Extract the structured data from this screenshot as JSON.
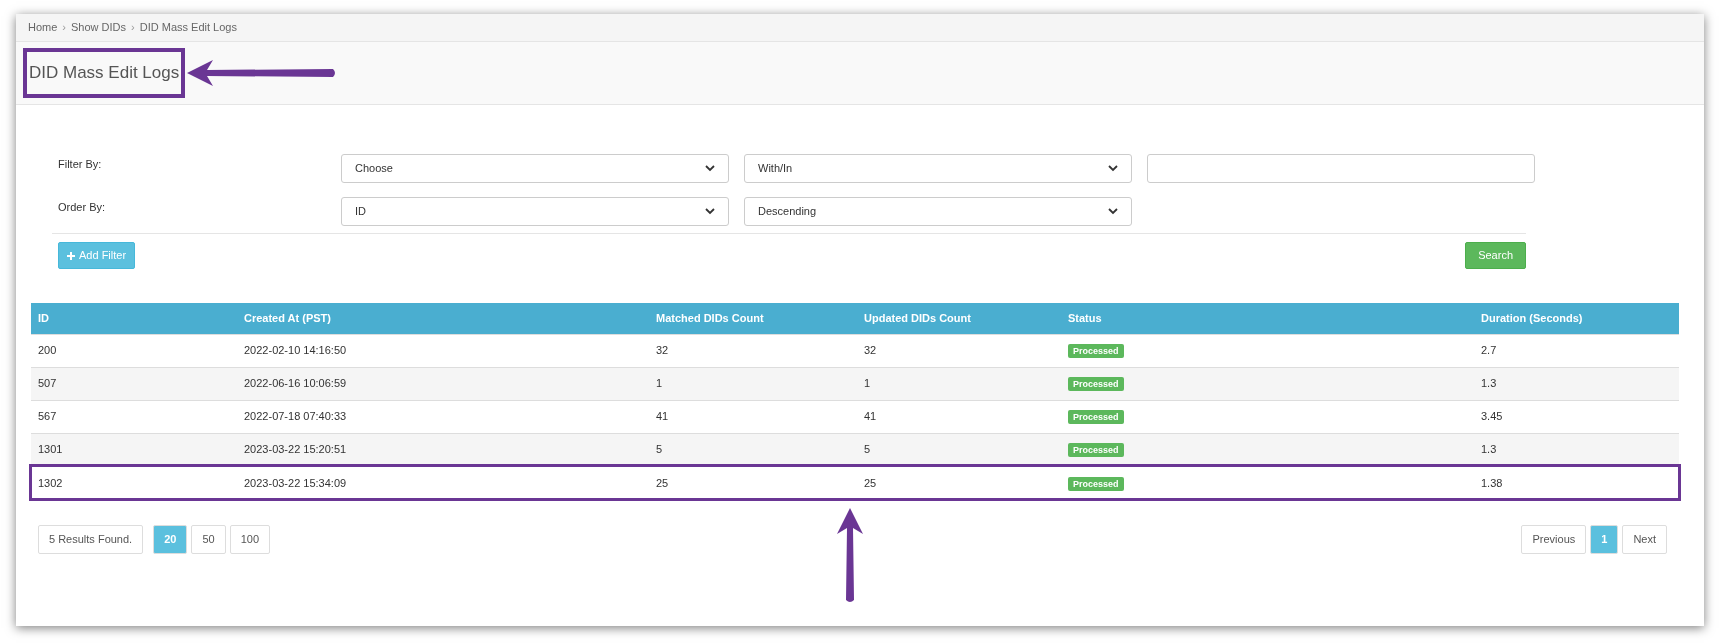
{
  "breadcrumb": [
    "Home",
    "Show DIDs",
    "DID Mass Edit Logs"
  ],
  "breadcrumb_separator": "›",
  "title": {
    "text": "DID Mass Edit Logs",
    "highlighted": true
  },
  "filter": {
    "label": "Filter By:",
    "field_select": "Choose",
    "operator_select": "With/In"
  },
  "order": {
    "label": "Order By:",
    "field_select": "ID",
    "direction_select": "Descending"
  },
  "add_filter_button": "Add Filter",
  "search_button": "Search",
  "table": {
    "columns": [
      "ID",
      "Created At (PST)",
      "Matched DIDs Count",
      "Updated DIDs Count",
      "Status",
      "Duration (Seconds)"
    ],
    "rows": [
      {
        "cells": [
          "200",
          "2022-02-10 14:16:50",
          "32",
          "32",
          "Processed",
          "2.7"
        ],
        "highlighted": false
      },
      {
        "cells": [
          "507",
          "2022-06-16 10:06:59",
          "1",
          "1",
          "Processed",
          "1.3"
        ],
        "highlighted": false
      },
      {
        "cells": [
          "567",
          "2022-07-18 07:40:33",
          "41",
          "41",
          "Processed",
          "3.45"
        ],
        "highlighted": false
      },
      {
        "cells": [
          "1301",
          "2023-03-22 15:20:51",
          "5",
          "5",
          "Processed",
          "1.3"
        ],
        "highlighted": false
      },
      {
        "cells": [
          "1302",
          "2023-03-22 15:34:09",
          "25",
          "25",
          "Processed",
          "1.38"
        ],
        "highlighted": true
      }
    ]
  },
  "results_text": "5 Results Found.",
  "page_sizes": [
    {
      "label": "20",
      "selected": true
    },
    {
      "label": "50",
      "selected": false
    },
    {
      "label": "100",
      "selected": false
    }
  ],
  "pagination": {
    "previous": "Previous",
    "pages": [
      {
        "label": "1",
        "selected": true
      }
    ],
    "next": "Next"
  }
}
